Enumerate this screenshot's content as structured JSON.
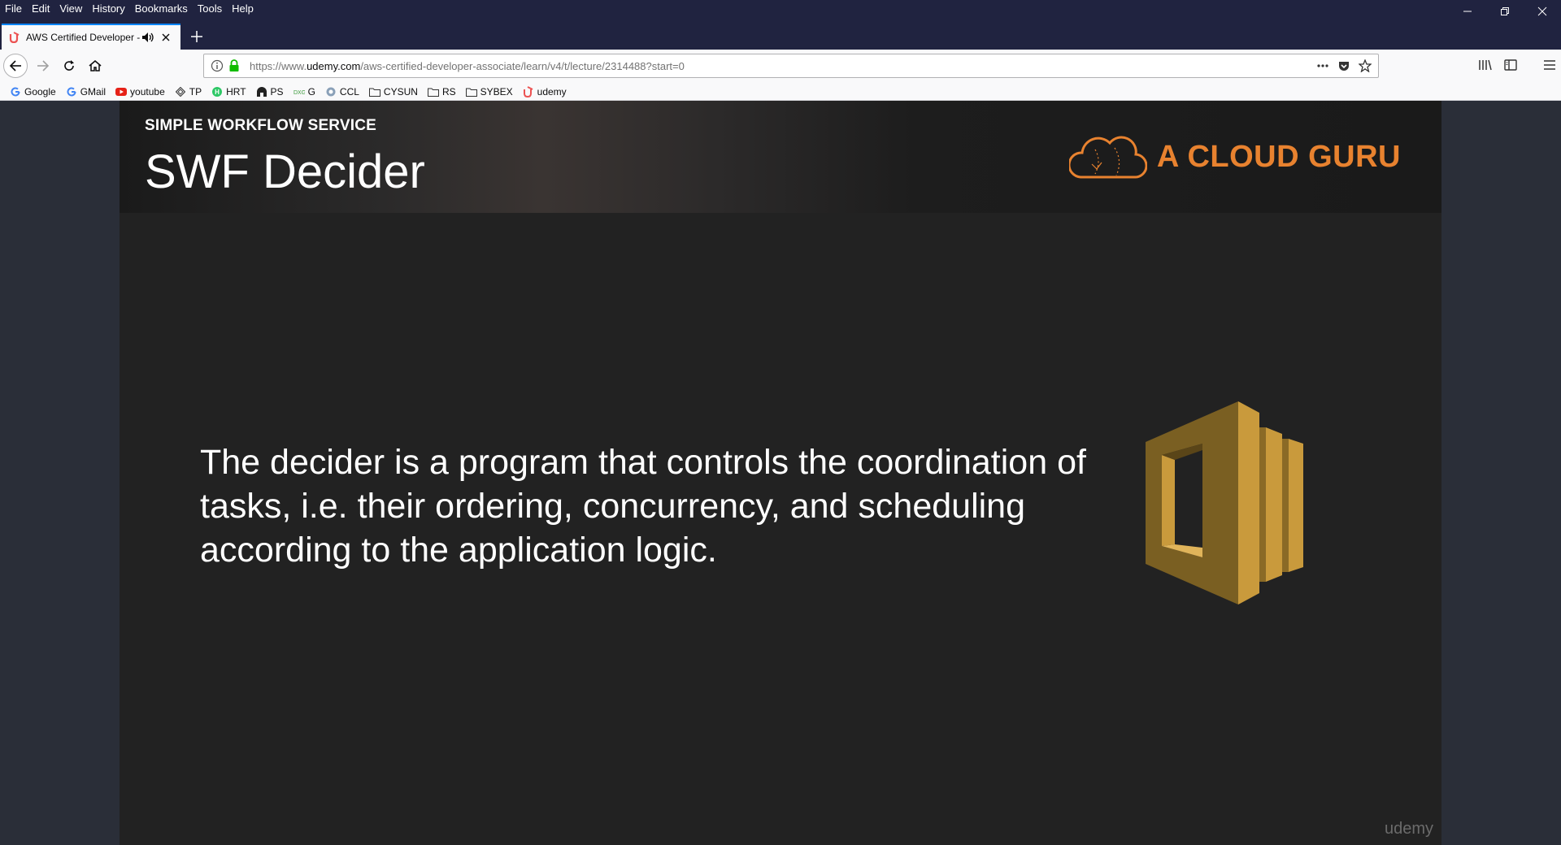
{
  "menu": [
    "File",
    "Edit",
    "View",
    "History",
    "Bookmarks",
    "Tools",
    "Help"
  ],
  "tab": {
    "title": "AWS Certified Developer - A"
  },
  "url": {
    "prefix": "https://www.",
    "domain": "udemy.com",
    "path": "/aws-certified-developer-associate/learn/v4/t/lecture/2314488?start=0"
  },
  "bookmarks": [
    {
      "label": "Google",
      "icon": "google-icon"
    },
    {
      "label": "GMail",
      "icon": "google-icon"
    },
    {
      "label": "youtube",
      "icon": "youtube-icon"
    },
    {
      "label": "TP",
      "icon": "tp-icon"
    },
    {
      "label": "HRT",
      "icon": "hrt-icon"
    },
    {
      "label": "PS",
      "icon": "ps-icon"
    },
    {
      "label": "G",
      "icon": "dxg-icon"
    },
    {
      "label": "CCL",
      "icon": "ccl-icon"
    },
    {
      "label": "CYSUN",
      "icon": "folder-icon"
    },
    {
      "label": "RS",
      "icon": "folder-icon"
    },
    {
      "label": "SYBEX",
      "icon": "folder-icon"
    },
    {
      "label": "udemy",
      "icon": "udemy-icon"
    }
  ],
  "slide": {
    "kicker": "SIMPLE WORKFLOW SERVICE",
    "title": "SWF Decider",
    "brand": "A CLOUD GURU",
    "body": "The decider is a program that controls the coordination of tasks, i.e. their ordering, concurrency, and scheduling according to the application logic.",
    "watermark": "udemy"
  },
  "colors": {
    "brand_orange": "#e8822f",
    "swf_gold": "#c99a3c",
    "tab_accent": "#0a84ff"
  }
}
